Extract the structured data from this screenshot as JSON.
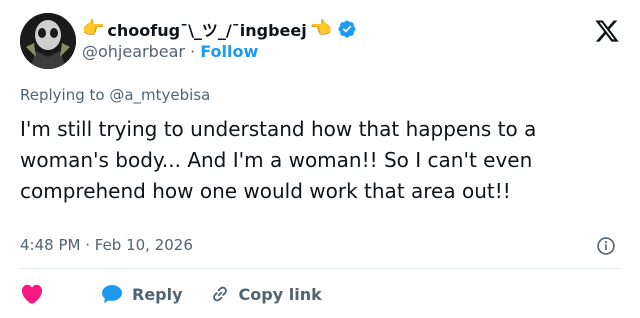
{
  "author": {
    "display_name": "choofug¯\\_ツ_/¯ingbeej",
    "left_hand": "👈",
    "right_hand": "👉",
    "handle": "@ohjearbear",
    "separator": "·",
    "follow_label": "Follow"
  },
  "reply": {
    "prefix": "Replying to",
    "mention": "@a_mtyebisa"
  },
  "tweet": {
    "text": "I'm still trying to understand how that happens to a woman's body... And I'm a woman!! So I can't even comprehend how one would work that area out!!",
    "timestamp": "4:48 PM · Feb 10, 2026"
  },
  "actions": {
    "reply_label": "Reply",
    "copy_link_label": "Copy link"
  },
  "icons": {
    "logo": "x-logo-icon",
    "verified": "verified-badge-icon",
    "info": "info-icon",
    "like": "heart-icon",
    "reply": "speech-bubble-icon",
    "copy": "link-icon"
  },
  "colors": {
    "verified": "#1d9bf0",
    "follow": "#1d9bf0",
    "heart": "#f91880",
    "reply_bubble": "#1d9bf0",
    "secondary_text": "#536471"
  }
}
